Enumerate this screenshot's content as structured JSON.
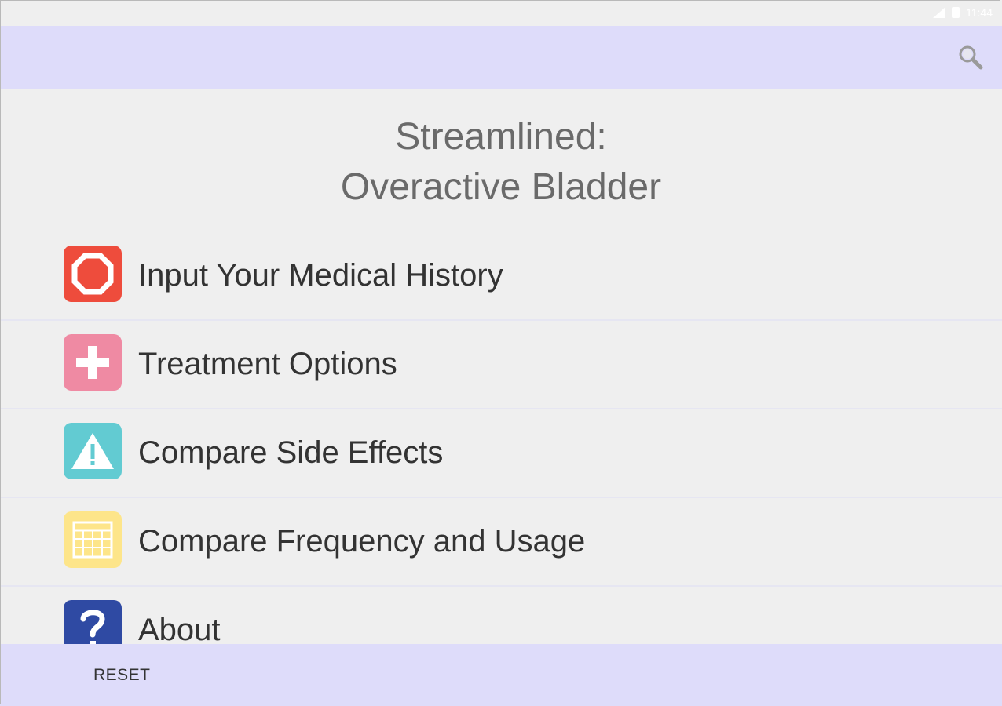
{
  "status_bar": {
    "time": "11:44"
  },
  "app_bar": {
    "search_icon": "search-icon"
  },
  "title": {
    "line1": "Streamlined:",
    "line2": "Overactive Bladder"
  },
  "menu": {
    "items": [
      {
        "label": "Input Your Medical History",
        "icon": "stop-octagon-icon",
        "color": "#ee4c3c"
      },
      {
        "label": "Treatment Options",
        "icon": "plus-cross-icon",
        "color": "#ef8aa3"
      },
      {
        "label": "Compare Side Effects",
        "icon": "warning-triangle-icon",
        "color": "#62cbd2"
      },
      {
        "label": "Compare Frequency and Usage",
        "icon": "calendar-grid-icon",
        "color": "#fde58a"
      },
      {
        "label": "About",
        "icon": "question-mark-icon",
        "color": "#2f4aa3"
      }
    ]
  },
  "bottom_bar": {
    "reset_label": "RESET"
  },
  "colors": {
    "bar_background": "#dedcfa",
    "page_background": "#efefef"
  }
}
